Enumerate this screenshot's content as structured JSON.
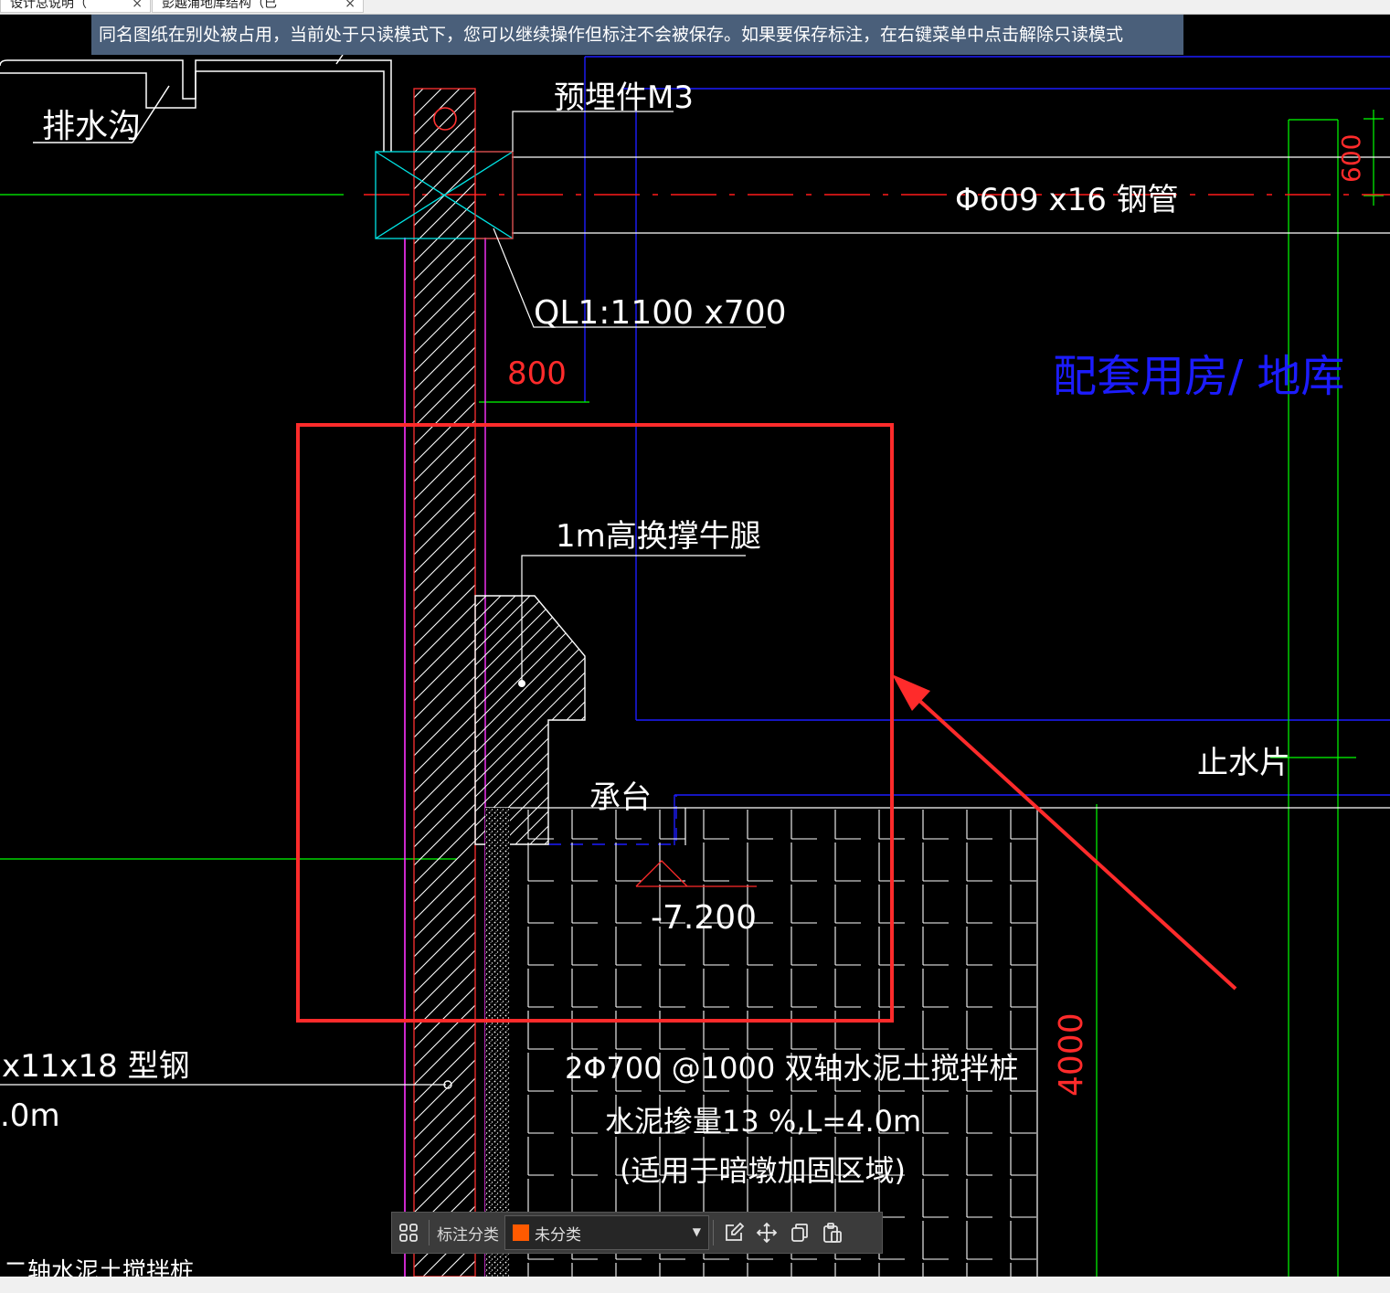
{
  "tabs": [
    {
      "label": "设计总说明（",
      "close": "×"
    },
    {
      "label": "彭越浦地库结构（已",
      "close": "×"
    }
  ],
  "notice": "同名图纸在别处被占用，当前处于只读模式下，您可以继续操作但标注不会被保存。如果要保存标注，在右键菜单中点击解除只读模式",
  "drawing": {
    "labels": {
      "drain": "排水沟",
      "embedded": "预埋件M3",
      "steel_pipe": "Φ609 x16 钢管",
      "dim_600": "600",
      "ql1": "QL1:1100 x700",
      "dim_800": "800",
      "area": "配套用房/ 地库",
      "corbel": "1m高换撑牛腿",
      "waterstop": "止水片",
      "pile_cap": "承台",
      "elevation": "-7.200",
      "steel_section": "x11x18 型钢",
      "steel_len": ".0m",
      "mix_pile_1": "2Φ700 @1000 双轴水泥土搅拌桩",
      "mix_pile_2": "水泥掺量13 %,L=4.0m",
      "mix_pile_3": "(适用于暗墩加固区域)",
      "dim_4000": "4000",
      "bottom_cut": "二轴水泥土搅拌桩"
    },
    "colors": {
      "white": "#ffffff",
      "red": "#ff1a1a",
      "green": "#00ff00",
      "blue": "#1c1cff",
      "magenta": "#ff33ff",
      "cyan": "#00e5e5",
      "annotation_red": "#ff2b2b"
    }
  },
  "toolbar": {
    "grid_icon": "grid-icon",
    "label": "标注分类",
    "select_value": "未分类",
    "select_color": "#ff5a00",
    "icons": [
      "edit-icon",
      "move-icon",
      "copy-icon",
      "paste-icon"
    ]
  }
}
